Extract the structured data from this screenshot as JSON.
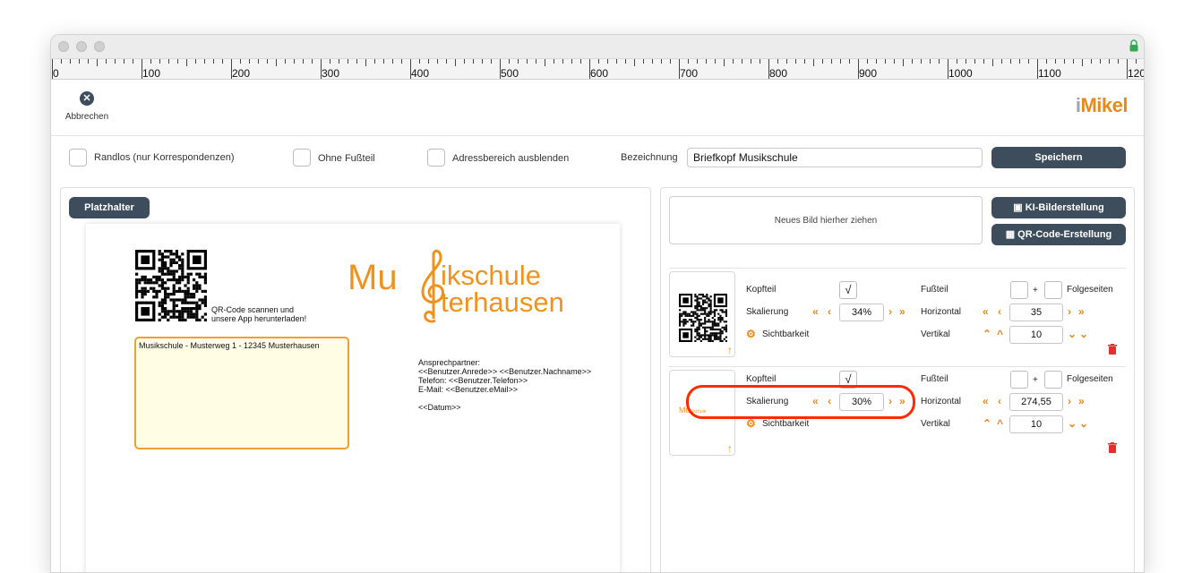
{
  "ruler": {
    "labels": [
      "0",
      "100",
      "200",
      "300",
      "400",
      "500",
      "600",
      "700",
      "800",
      "900",
      "1000",
      "1100",
      "120"
    ]
  },
  "toolbar": {
    "cancel_label": "Abbrechen",
    "logo_text": "Mikel",
    "logo_i": "i"
  },
  "options": {
    "randlos_label": "Randlos (nur Korrespondenzen)",
    "ohne_fussteil_label": "Ohne Fußteil",
    "adressbereich_label": "Adressbereich ausblenden",
    "bezeichnung_label": "Bezeichnung",
    "bezeichnung_value": "Briefkopf Musikschule",
    "save_label": "Speichern"
  },
  "left": {
    "platzhalter_label": "Platzhalter",
    "qr_caption_1": "QR-Code scannen und",
    "qr_caption_2": "unsere App herunterladen!",
    "logo_line1_a": "Mu",
    "logo_line1_b": "ikschule",
    "logo_line2": "terhausen",
    "address_line": "Musikschule - Musterweg 1 - 12345 Musterhausen",
    "contact": [
      "Ansprechpartner:",
      "<<Benutzer.Anrede>> <<Benutzer.Nachname>>",
      "Telefon: <<Benutzer.Telefon>>",
      "E-Mail: <<Benutzer.eMail>>",
      "",
      "<<Datum>>"
    ]
  },
  "right": {
    "dropzone_label": "Neues Bild hierher ziehen",
    "ki_label": "KI-Bilderstellung",
    "qr_label": "QR-Code-Erstellung",
    "labels": {
      "kopfteil": "Kopfteil",
      "fussteil": "Fußteil",
      "plus": "+",
      "folgeseiten": "Folgeseiten",
      "skalierung": "Skalierung",
      "horizontal": "Horizontal",
      "sichtbarkeit": "Sichtbarkeit",
      "vertikal": "Vertikal"
    },
    "rows": [
      {
        "kopfteil": "√",
        "skalierung": "34%",
        "horizontal": "35",
        "vertikal": "10"
      },
      {
        "kopfteil": "√",
        "skalierung": "30%",
        "horizontal": "274,55",
        "vertikal": "10"
      }
    ]
  },
  "colors": {
    "accent": "#e8891d",
    "button": "#3d4d5c",
    "highlight": "#ff2a00",
    "address_bg": "#fffde3"
  }
}
